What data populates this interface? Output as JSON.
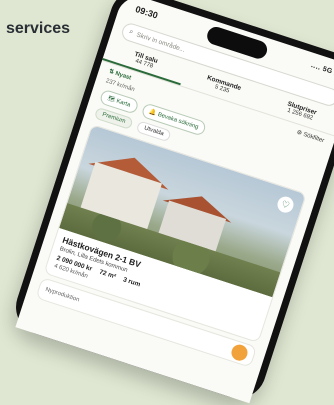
{
  "page": {
    "heading": "services"
  },
  "phone": {
    "status": {
      "time": "09:30",
      "signal": "‥‥ 5G ▬"
    },
    "search": {
      "placeholder": "Skriv in område..."
    },
    "tabs": [
      {
        "label": "Till salu",
        "count": "44 778",
        "active": true
      },
      {
        "label": "Kommande",
        "count": "5 235",
        "active": false
      },
      {
        "label": "Slutpriser",
        "count": "1 256 692",
        "active": false
      }
    ],
    "toolbar": {
      "sort": "Nyast",
      "save": "Sökfilter",
      "save_prefix": "Bevaka sökning"
    },
    "prev_meta": "237 kr/mån",
    "actions": {
      "map": "Karta",
      "watch": "Bevaka sökning"
    },
    "chips": [
      "Premium",
      "Utvalda"
    ],
    "listing": {
      "address": "Hästkovägen 2-1 BV",
      "location": "Brolin, Lilla Edets kommun",
      "price": "2 090 000 kr",
      "area": "72 m²",
      "rooms": "3 rum",
      "monthly": "4 620 kr/mån"
    },
    "next": {
      "label": "Nyproduktion"
    }
  }
}
